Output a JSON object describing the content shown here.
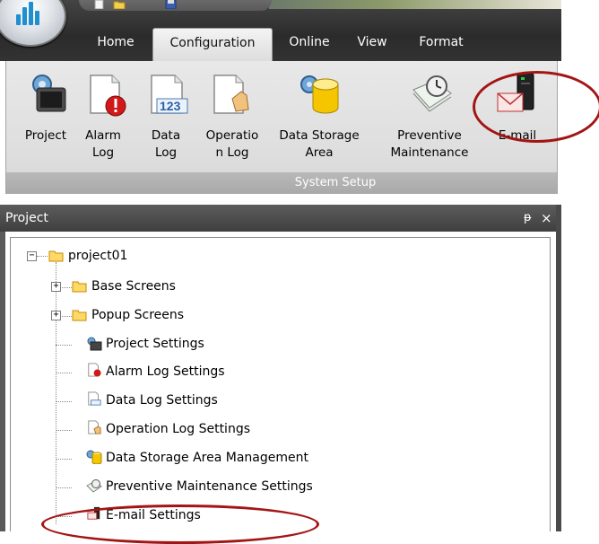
{
  "ribbon_tabs": [
    {
      "label": "Home"
    },
    {
      "label": "Configuration",
      "active": true
    },
    {
      "label": "Online"
    },
    {
      "label": "View"
    },
    {
      "label": "Format"
    }
  ],
  "ribbon_buttons": [
    {
      "label": "Project",
      "icon": "project-icon"
    },
    {
      "label": "Alarm\nLog",
      "icon": "alarm-log-icon"
    },
    {
      "label": "Data\nLog",
      "icon": "data-log-icon"
    },
    {
      "label": "Operatio\nn Log",
      "icon": "operation-log-icon"
    },
    {
      "label": "Data Storage\nArea",
      "icon": "data-storage-icon"
    },
    {
      "label": "Preventive\nMaintenance",
      "icon": "preventive-maintenance-icon"
    },
    {
      "label": "E-mail",
      "icon": "email-icon"
    }
  ],
  "ribbon_group_label": "System Setup",
  "panel": {
    "title": "Project",
    "pin_glyph": "ᵽ",
    "close_glyph": "×"
  },
  "tree": {
    "root": {
      "label": "project01",
      "expander": "−"
    },
    "children": [
      {
        "label": "Base Screens",
        "expander": "+",
        "icon": "folder-icon"
      },
      {
        "label": "Popup Screens",
        "expander": "+",
        "icon": "folder-icon"
      },
      {
        "label": "Project Settings",
        "icon": "project-settings-icon"
      },
      {
        "label": "Alarm Log Settings",
        "icon": "alarm-log-settings-icon"
      },
      {
        "label": "Data Log Settings",
        "icon": "data-log-settings-icon"
      },
      {
        "label": "Operation Log Settings",
        "icon": "operation-log-settings-icon"
      },
      {
        "label": "Data Storage Area Management",
        "icon": "data-storage-icon"
      },
      {
        "label": "Preventive Maintenance Settings",
        "icon": "preventive-maintenance-icon"
      },
      {
        "label": "E-mail Settings",
        "icon": "email-settings-icon"
      }
    ]
  },
  "colors": {
    "annotation": "#a31515",
    "ribbon_dark": "#2b2b2b",
    "orb_bars": "#1f8fd0"
  }
}
